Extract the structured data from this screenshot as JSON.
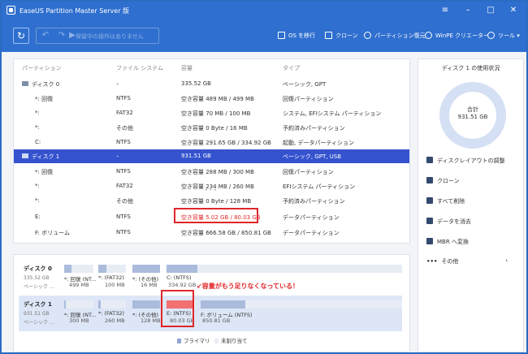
{
  "app": {
    "title": "EaseUS Partition Master Server 版"
  },
  "window_controls": {
    "menu": "≡",
    "minimize": "–",
    "maximize": "□",
    "close": "✕"
  },
  "toolbar": {
    "pending_label": "保留中の操作はありません",
    "os_migrate": "OS を移行",
    "clone": "クローン",
    "partition_recovery": "パーティション復元",
    "winpe": "WinPE クリエーター",
    "tools": "ツール"
  },
  "table": {
    "headers": [
      "パーティション",
      "ファイル システム",
      "容量",
      "タイプ"
    ],
    "rows": [
      {
        "kind": "disk",
        "name": "ディスク 0",
        "fs": "–",
        "capacity": "335.52 GB",
        "type": "ベーシック, GPT"
      },
      {
        "kind": "part",
        "name": "*: 回復",
        "fs": "NTFS",
        "capacity": "空き容量 489 MB / 499 MB",
        "type": "回復パーティション"
      },
      {
        "kind": "part",
        "name": "*:",
        "fs": "FAT32",
        "capacity": "空き容量 70 MB / 100 MB",
        "type": "システム, EFIシステム パーティション"
      },
      {
        "kind": "part",
        "name": "*:",
        "fs": "その他",
        "capacity": "空き容量 0 Byte / 16 MB",
        "type": "予約済みパーティション"
      },
      {
        "kind": "part",
        "name": "C:",
        "fs": "NTFS",
        "capacity": "空き容量 291.65 GB / 334.92 GB",
        "type": "起動, データパーティション"
      },
      {
        "kind": "disk",
        "name": "ディスク 1",
        "fs": "–",
        "capacity": "931.51 GB",
        "type": "ベーシック, GPT, USB"
      },
      {
        "kind": "part",
        "name": "*: 回復",
        "fs": "NTFS",
        "capacity": "空き容量 288 MB / 300 MB",
        "type": "回復パーティション"
      },
      {
        "kind": "part",
        "name": "*:",
        "fs": "FAT32",
        "capacity": "空き容量 234 MB / 260 MB",
        "type": "EFIシステム パーティション"
      },
      {
        "kind": "part",
        "name": "*:",
        "fs": "その他",
        "capacity": "空き容量 0 Byte / 128 MB",
        "type": "予約済みパーティション"
      },
      {
        "kind": "part",
        "name": "E:",
        "fs": "NTFS",
        "capacity": "空き容量 5.02 GB / 80.03 GB",
        "type": "データパーティション"
      },
      {
        "kind": "part",
        "name": "F: ボリューム",
        "fs": "NTFS",
        "capacity": "空き容量 666.58 GB / 850.81 GB",
        "type": "データパーティション"
      }
    ],
    "ellipsis": "• • •"
  },
  "side": {
    "title": "ディスク 1 の使用状況",
    "total_label": "合計",
    "total_value": "931.51 GB",
    "actions": [
      "ディスクレイアウトの調整",
      "クローン",
      "すべて削除",
      "データを消去",
      "MBR へ変換",
      "その他"
    ]
  },
  "map": {
    "disk0": {
      "name": "ディスク 0",
      "size": "335.52 GB",
      "type": "ベーシック ...",
      "parts": [
        {
          "label": "*: 回復 (NT...",
          "size": "499 MB",
          "used": 0.25
        },
        {
          "label": "*: (FAT32)",
          "size": "100 MB",
          "used": 0.3
        },
        {
          "label": "*: (その他)",
          "size": "16 MB",
          "used": 1.0
        },
        {
          "label": "C: (NTFS)",
          "size": "334.92 GB",
          "used": 0.13
        }
      ]
    },
    "disk1": {
      "name": "ディスク 1",
      "size": "931.51 GB",
      "type": "ベーシック ...",
      "parts": [
        {
          "label": "*: 回復 (NT...",
          "size": "300 MB",
          "used": 0.05
        },
        {
          "label": "*: (FAT32)",
          "size": "260 MB",
          "used": 0.1
        },
        {
          "label": "*: (その他)",
          "size": "128 MB",
          "used": 1.0
        },
        {
          "label": "E: (NTFS)",
          "size": "80.03 GB",
          "used": 0.94
        },
        {
          "label": "F: ボリューム (NTFS)",
          "size": "850.81 GB",
          "used": 0.22
        }
      ]
    },
    "annotation": "↙容量がもう足りなくなっている！",
    "legend": {
      "primary": "プライマリ",
      "unallocated": "未割り当て"
    }
  },
  "colors": {
    "brand": "#2f6fcf",
    "selected_row": "#3553cf",
    "highlight": "#e0262a",
    "e_partition_fill": "#f27070"
  }
}
